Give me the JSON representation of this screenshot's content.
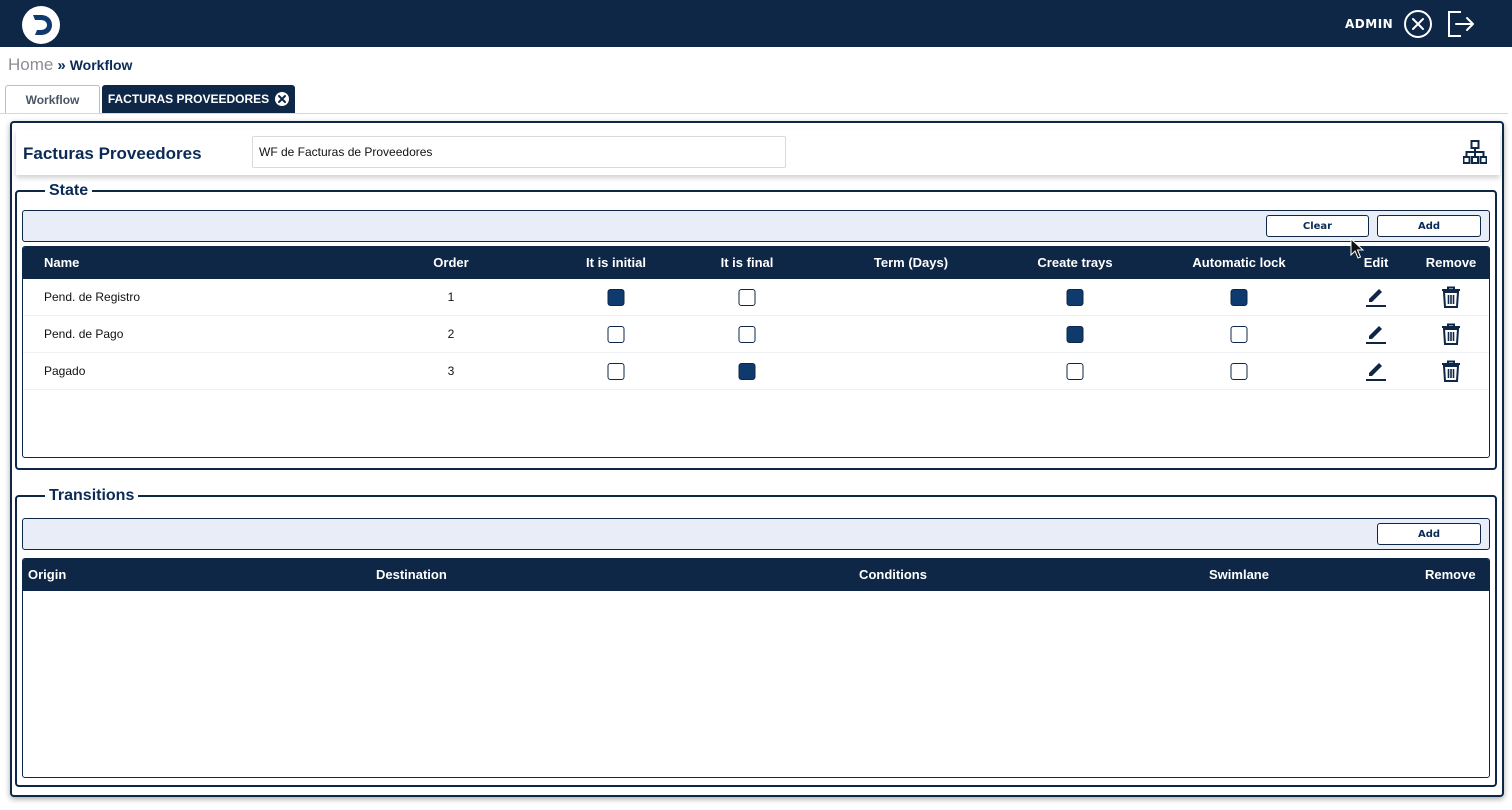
{
  "app": {
    "user_label": "ADMIN",
    "icons": {
      "logo": "logo-d",
      "close": "circle-x-icon",
      "logout": "logout-icon"
    }
  },
  "breadcrumb": {
    "home": "Home",
    "separator": "»",
    "current": "Workflow"
  },
  "tabs": [
    {
      "label": "Workflow",
      "active": false
    },
    {
      "label": "FACTURAS PROVEEDORES",
      "active": true
    }
  ],
  "workflow": {
    "name": "Facturas Proveedores",
    "description": "WF de Facturas de Proveedores"
  },
  "state": {
    "legend": "State",
    "buttons": {
      "clear": "Clear",
      "add": "Add"
    },
    "columns": [
      "Name",
      "Order",
      "It is initial",
      "It is final",
      "Term (Days)",
      "Create trays",
      "Automatic lock",
      "Edit",
      "Remove"
    ],
    "rows": [
      {
        "name": "Pend. de Registro",
        "order": "1",
        "initial": true,
        "final": false,
        "term": "",
        "create_trays": true,
        "automatic_lock": true
      },
      {
        "name": "Pend. de Pago",
        "order": "2",
        "initial": false,
        "final": false,
        "term": "",
        "create_trays": true,
        "automatic_lock": false
      },
      {
        "name": "Pagado",
        "order": "3",
        "initial": false,
        "final": true,
        "term": "",
        "create_trays": false,
        "automatic_lock": false
      }
    ]
  },
  "transitions": {
    "legend": "Transitions",
    "buttons": {
      "add": "Add"
    },
    "columns": [
      "Origin",
      "Destination",
      "Conditions",
      "Swimlane",
      "Remove"
    ],
    "rows": []
  },
  "colors": {
    "primary": "#0e2747",
    "toolbar_bg": "#e9edf8",
    "checked": "#0e3a6e"
  }
}
